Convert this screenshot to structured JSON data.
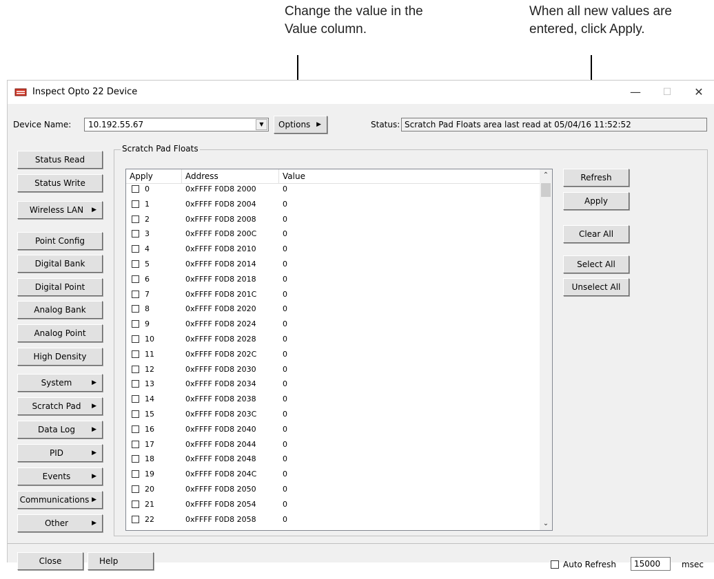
{
  "annotations": {
    "left": "Change the value in the\nValue column.",
    "right": "When all new values are\nentered, click Apply."
  },
  "window": {
    "title": "Inspect Opto 22 Device",
    "minimize": "—",
    "maximize": "☐",
    "close": "✕"
  },
  "device": {
    "label": "Device Name:",
    "value": "10.192.55.67",
    "options_label": "Options",
    "status_label": "Status:",
    "status_value": "Scratch Pad Floats area last read at 05/04/16 11:52:52"
  },
  "nav": [
    {
      "label": "Status Read",
      "submenu": false
    },
    {
      "label": "Status Write",
      "submenu": false
    },
    {
      "label": "Wireless LAN",
      "submenu": true
    },
    {
      "label": "Point Config",
      "submenu": false
    },
    {
      "label": "Digital Bank",
      "submenu": false
    },
    {
      "label": "Digital Point",
      "submenu": false
    },
    {
      "label": "Analog Bank",
      "submenu": false
    },
    {
      "label": "Analog Point",
      "submenu": false
    },
    {
      "label": "High Density",
      "submenu": false
    },
    {
      "label": "System",
      "submenu": true
    },
    {
      "label": "Scratch Pad",
      "submenu": true
    },
    {
      "label": "Data Log",
      "submenu": true
    },
    {
      "label": "PID",
      "submenu": true
    },
    {
      "label": "Events",
      "submenu": true
    },
    {
      "label": "Communications",
      "submenu": true
    },
    {
      "label": "Other",
      "submenu": true
    }
  ],
  "group_title": "Scratch Pad Floats",
  "table": {
    "columns": [
      "Apply",
      "Address",
      "Value"
    ],
    "rows": [
      {
        "index": "0",
        "address": "0xFFFF F0D8 2000",
        "value": "0"
      },
      {
        "index": "1",
        "address": "0xFFFF F0D8 2004",
        "value": "0"
      },
      {
        "index": "2",
        "address": "0xFFFF F0D8 2008",
        "value": "0"
      },
      {
        "index": "3",
        "address": "0xFFFF F0D8 200C",
        "value": "0"
      },
      {
        "index": "4",
        "address": "0xFFFF F0D8 2010",
        "value": "0"
      },
      {
        "index": "5",
        "address": "0xFFFF F0D8 2014",
        "value": "0"
      },
      {
        "index": "6",
        "address": "0xFFFF F0D8 2018",
        "value": "0"
      },
      {
        "index": "7",
        "address": "0xFFFF F0D8 201C",
        "value": "0"
      },
      {
        "index": "8",
        "address": "0xFFFF F0D8 2020",
        "value": "0"
      },
      {
        "index": "9",
        "address": "0xFFFF F0D8 2024",
        "value": "0"
      },
      {
        "index": "10",
        "address": "0xFFFF F0D8 2028",
        "value": "0"
      },
      {
        "index": "11",
        "address": "0xFFFF F0D8 202C",
        "value": "0"
      },
      {
        "index": "12",
        "address": "0xFFFF F0D8 2030",
        "value": "0"
      },
      {
        "index": "13",
        "address": "0xFFFF F0D8 2034",
        "value": "0"
      },
      {
        "index": "14",
        "address": "0xFFFF F0D8 2038",
        "value": "0"
      },
      {
        "index": "15",
        "address": "0xFFFF F0D8 203C",
        "value": "0"
      },
      {
        "index": "16",
        "address": "0xFFFF F0D8 2040",
        "value": "0"
      },
      {
        "index": "17",
        "address": "0xFFFF F0D8 2044",
        "value": "0"
      },
      {
        "index": "18",
        "address": "0xFFFF F0D8 2048",
        "value": "0"
      },
      {
        "index": "19",
        "address": "0xFFFF F0D8 204C",
        "value": "0"
      },
      {
        "index": "20",
        "address": "0xFFFF F0D8 2050",
        "value": "0"
      },
      {
        "index": "21",
        "address": "0xFFFF F0D8 2054",
        "value": "0"
      },
      {
        "index": "22",
        "address": "0xFFFF F0D8 2058",
        "value": "0"
      }
    ]
  },
  "actions": {
    "refresh": "Refresh",
    "apply": "Apply",
    "clear_all": "Clear All",
    "select_all": "Select All",
    "unselect_all": "Unselect All"
  },
  "footer": {
    "close": "Close",
    "help": "Help",
    "auto_refresh_label": "Auto Refresh",
    "interval_value": "15000",
    "unit": "msec"
  }
}
